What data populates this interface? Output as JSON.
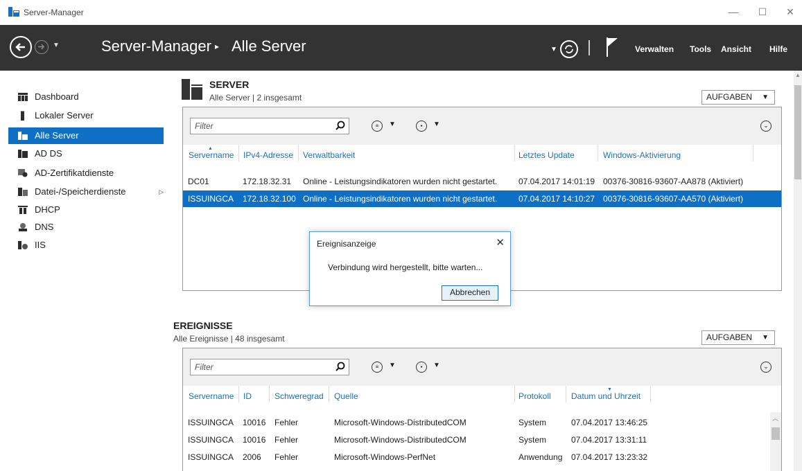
{
  "window": {
    "title": "Server-Manager",
    "minimize": "—",
    "maximize": "☐",
    "close": "✕"
  },
  "header": {
    "title": "Server-Manager",
    "separator": "▸",
    "subtitle": "Alle Server",
    "menu": [
      "Verwalten",
      "Tools",
      "Ansicht",
      "Hilfe"
    ]
  },
  "sidebar": {
    "items": [
      {
        "label": "Dashboard",
        "icon": "dashboard-icon"
      },
      {
        "label": "Lokaler Server",
        "icon": "server-icon"
      },
      {
        "label": "Alle Server",
        "icon": "servers-icon",
        "active": true
      },
      {
        "label": "AD DS",
        "icon": "ad-ds-icon"
      },
      {
        "label": "AD-Zertifikatdienste",
        "icon": "certificate-icon"
      },
      {
        "label": "Datei-/Speicherdienste",
        "icon": "storage-icon",
        "has_submenu": true
      },
      {
        "label": "DHCP",
        "icon": "dhcp-icon"
      },
      {
        "label": "DNS",
        "icon": "dns-icon"
      },
      {
        "label": "IIS",
        "icon": "iis-icon"
      }
    ]
  },
  "server_section": {
    "title": "SERVER",
    "subtitle": "Alle Server | 2 insgesamt",
    "tasks_label": "AUFGABEN",
    "filter_placeholder": "Filter",
    "columns": [
      "Servername",
      "IPv4-Adresse",
      "Verwaltbarkeit",
      "Letztes Update",
      "Windows-Aktivierung"
    ],
    "rows": [
      [
        "DC01",
        "172.18.32.31",
        "Online - Leistungsindikatoren wurden nicht gestartet.",
        "07.04.2017 14:01:19",
        "00376-30816-93607-AA878 (Aktiviert)"
      ],
      [
        "ISSUINGCA",
        "172.18.32.100",
        "Online - Leistungsindikatoren wurden nicht gestartet.",
        "07.04.2017 14:10:27",
        "00376-30816-93607-AA570 (Aktiviert)"
      ]
    ]
  },
  "events_section": {
    "title": "EREIGNISSE",
    "subtitle": "Alle Ereignisse | 48 insgesamt",
    "tasks_label": "AUFGABEN",
    "filter_placeholder": "Filter",
    "columns": [
      "Servername",
      "ID",
      "Schweregrad",
      "Quelle",
      "Protokoll",
      "Datum und Uhrzeit"
    ],
    "rows": [
      [
        "ISSUINGCA",
        "10016",
        "Fehler",
        "Microsoft-Windows-DistributedCOM",
        "System",
        "07.04.2017 13:46:25"
      ],
      [
        "ISSUINGCA",
        "10016",
        "Fehler",
        "Microsoft-Windows-DistributedCOM",
        "System",
        "07.04.2017 13:31:11"
      ],
      [
        "ISSUINGCA",
        "2006",
        "Fehler",
        "Microsoft-Windows-PerfNet",
        "Anwendung",
        "07.04.2017 13:23:32"
      ]
    ]
  },
  "dialog": {
    "title": "Ereignisanzeige",
    "message": "Verbindung wird hergestellt, bitte warten...",
    "cancel_label": "Abbrechen",
    "close": "✕"
  },
  "colors": {
    "header_bg": "#333333",
    "accent": "#0f6fc5",
    "link": "#1d6fb8"
  }
}
